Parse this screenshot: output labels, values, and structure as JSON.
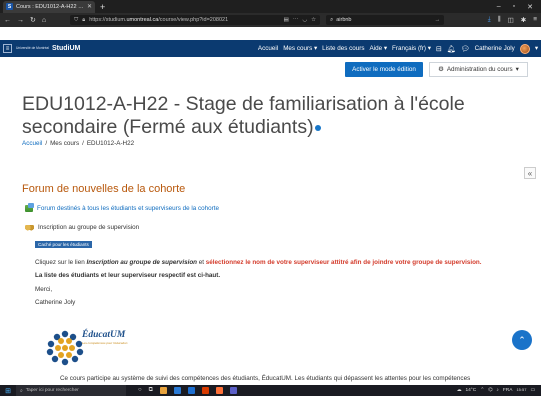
{
  "browser": {
    "tab_title": "Cours : EDU1012-A-H22 - Stag",
    "url_prefix": "https://studium.",
    "url_domain": "umontreal.ca",
    "url_path": "/course/view.php?id=208021",
    "search_value": "airbnb"
  },
  "topnav": {
    "university_logo": "Université de Montréal",
    "brand": "StudiUM",
    "links": [
      "Accueil",
      "Mes cours",
      "Liste des cours",
      "Aide",
      "Français (fr)"
    ],
    "user_name": "Catherine Joly"
  },
  "page": {
    "edit_button": "Activer le mode édition",
    "admin_button": "Administration du cours",
    "title": "EDU1012-A-H22 - Stage de familiarisation à l'école secondaire (Fermé aux étudiants)",
    "breadcrumb": [
      "Accueil",
      "Mes cours",
      "EDU1012-A-H22"
    ],
    "section_title": "Forum de nouvelles de la cohorte",
    "activity_forum": "Forum destinés à tous les étudiants et superviseurs de la cohorte",
    "activity_group": "Inscription au groupe de supervision",
    "hidden_badge": "Caché pour les étudiants",
    "line1_a": "Cliquez sur le lien ",
    "line1_b": "Inscription au groupe de supervision",
    "line1_c": " et ",
    "line1_d": "sélectionnez le nom de votre superviseur attitré afin de joindre votre groupe de supervision.",
    "line2": "La liste des étudiants et leur superviseur respectif est ci-haut.",
    "line3": "Merci,",
    "line4": "Catherine Joly",
    "logo_name": "ÉducatUM",
    "logo_tagline": "Les compétences pour l'éducation",
    "bottom_text": "Ce cours participe au système de suivi des compétences des étudiants, ÉducatUM. Les étudiants qui dépassent les attentes pour les compétences"
  },
  "taskbar": {
    "search_placeholder": "Taper ici pour rechercher",
    "weather": "14°C",
    "language": "FRA",
    "time": "15:57"
  }
}
